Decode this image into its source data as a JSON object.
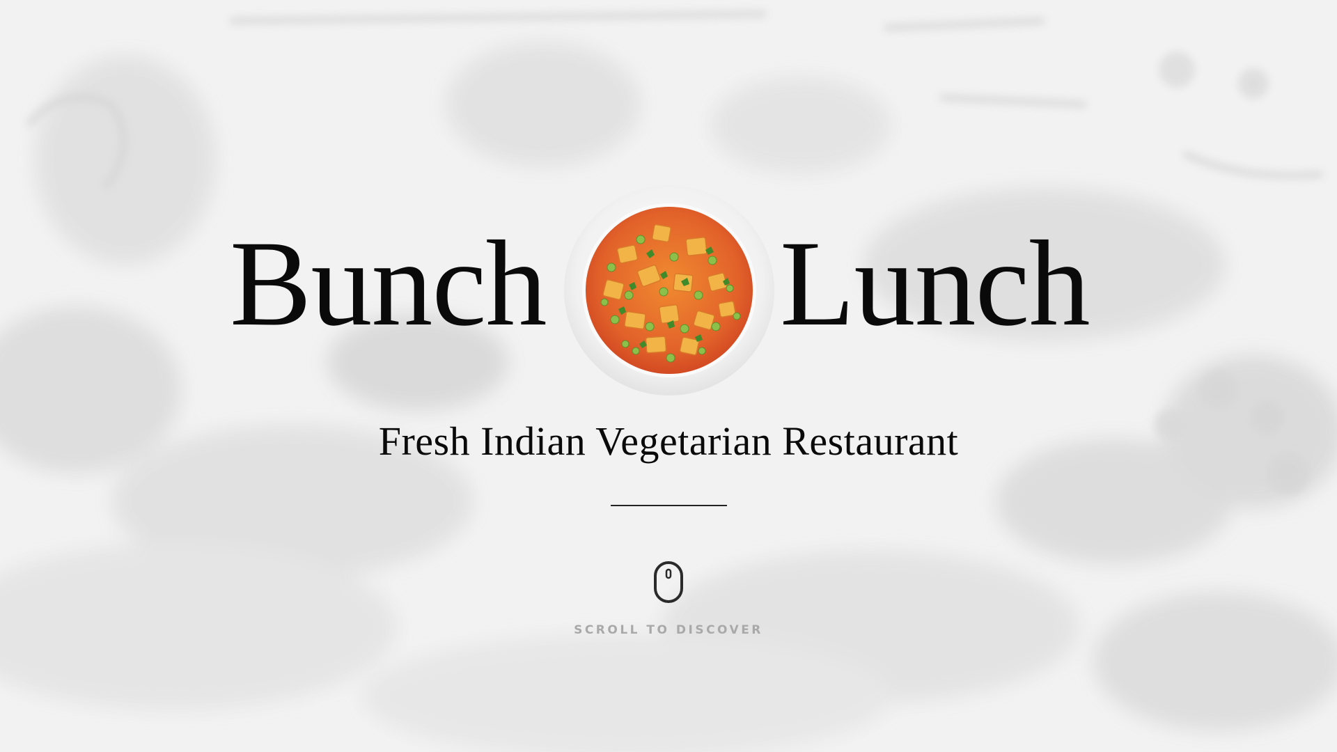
{
  "hero": {
    "title_left": "Bunch",
    "title_right": "Lunch",
    "subtitle": "Fresh Indian Vegetarian Restaurant",
    "dish_image": "paneer-curry-plate",
    "background_image": "faded-monochrome-dining-scene"
  },
  "scroll_cue": {
    "icon": "mouse-icon",
    "label": "SCROLL TO DISCOVER"
  },
  "colors": {
    "background": "#f3f3f3",
    "text": "#0a0a0a",
    "muted": "#a9a9a9",
    "curry": "#e8742a"
  }
}
